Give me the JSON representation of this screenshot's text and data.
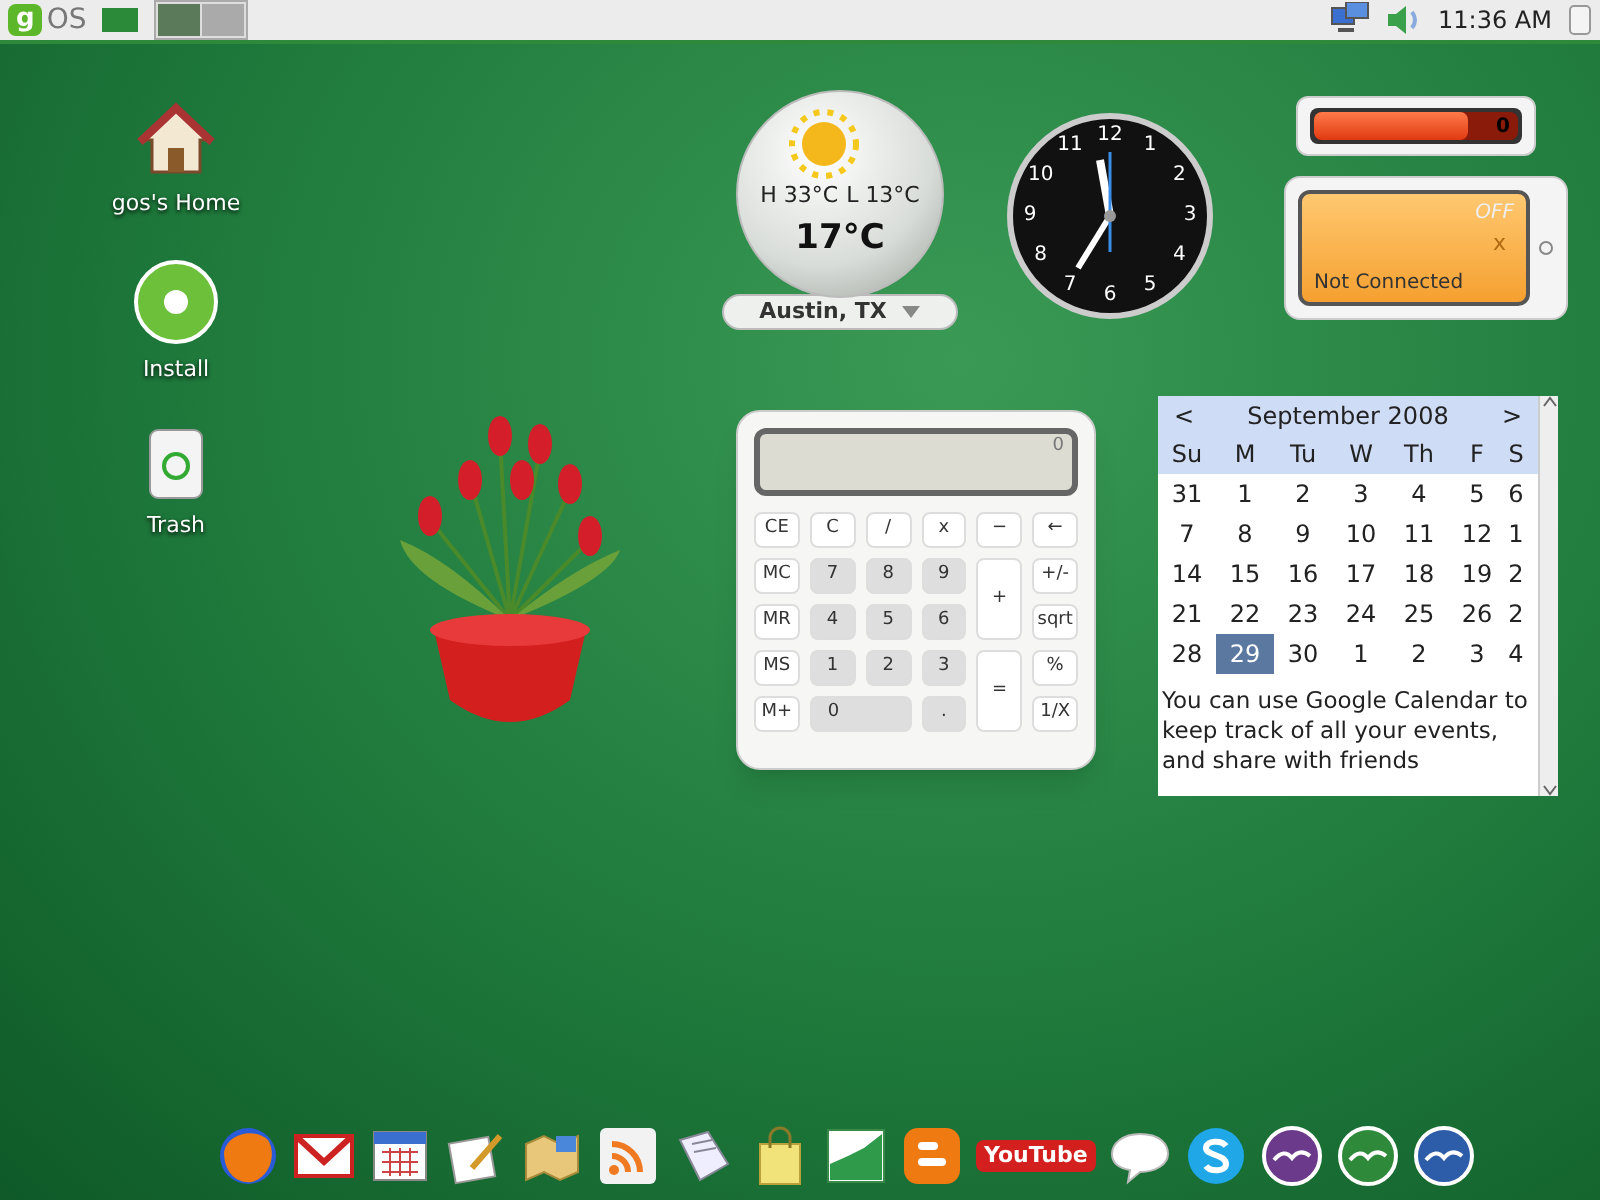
{
  "taskbar": {
    "logo": {
      "mark": "g",
      "text": "OS"
    },
    "workspaces": [
      {
        "selected": true
      },
      {
        "selected": false
      }
    ],
    "clock": "11:36 AM"
  },
  "desktop_icons": [
    {
      "kind": "home",
      "label": "gos's Home"
    },
    {
      "kind": "install",
      "label": "Install"
    },
    {
      "kind": "trash",
      "label": "Trash"
    }
  ],
  "weather": {
    "high": "H 33°C",
    "low": "L 13°C",
    "temperature": "17°C",
    "location": "Austin, TX"
  },
  "clock": {
    "numerals": [
      "12",
      "1",
      "2",
      "3",
      "4",
      "5",
      "6",
      "7",
      "8",
      "9",
      "10",
      "11"
    ]
  },
  "battery": {
    "level": 0.75,
    "reading": "0"
  },
  "wifi": {
    "state": "OFF",
    "mark": "x",
    "status": "Not Connected"
  },
  "calculator": {
    "display": "0",
    "keys": [
      {
        "label": "CE",
        "kind": "func"
      },
      {
        "label": "C",
        "kind": "func"
      },
      {
        "label": "/",
        "kind": "func"
      },
      {
        "label": "x",
        "kind": "func"
      },
      {
        "label": "−",
        "kind": "func"
      },
      {
        "label": "←",
        "kind": "func"
      },
      {
        "label": "MC",
        "kind": "func"
      },
      {
        "label": "7",
        "kind": "digit"
      },
      {
        "label": "8",
        "kind": "digit"
      },
      {
        "label": "9",
        "kind": "digit"
      },
      {
        "label": "+",
        "kind": "tall"
      },
      {
        "label": "+/-",
        "kind": "func"
      },
      {
        "label": "MR",
        "kind": "func"
      },
      {
        "label": "4",
        "kind": "digit"
      },
      {
        "label": "5",
        "kind": "digit"
      },
      {
        "label": "6",
        "kind": "digit"
      },
      {
        "label": "sqrt",
        "kind": "func"
      },
      {
        "label": "MS",
        "kind": "func"
      },
      {
        "label": "1",
        "kind": "digit"
      },
      {
        "label": "2",
        "kind": "digit"
      },
      {
        "label": "3",
        "kind": "digit"
      },
      {
        "label": "=",
        "kind": "tall"
      },
      {
        "label": "%",
        "kind": "func"
      },
      {
        "label": "M+",
        "kind": "func"
      },
      {
        "label": "0",
        "kind": "wide"
      },
      {
        "label": ".",
        "kind": "digit"
      },
      {
        "label": "1/X",
        "kind": "func"
      }
    ]
  },
  "calendar": {
    "prev": "<",
    "title": "September 2008",
    "next": ">",
    "weekdays": [
      "Su",
      "M",
      "Tu",
      "W",
      "Th",
      "F",
      "S"
    ],
    "weeks": [
      [
        {
          "day": "31",
          "selected": false
        },
        {
          "day": "1",
          "selected": false
        },
        {
          "day": "2",
          "selected": false
        },
        {
          "day": "3",
          "selected": false
        },
        {
          "day": "4",
          "selected": false
        },
        {
          "day": "5",
          "selected": false
        },
        {
          "day": "6",
          "selected": false
        }
      ],
      [
        {
          "day": "7",
          "selected": false
        },
        {
          "day": "8",
          "selected": false
        },
        {
          "day": "9",
          "selected": false
        },
        {
          "day": "10",
          "selected": false
        },
        {
          "day": "11",
          "selected": false
        },
        {
          "day": "12",
          "selected": false
        },
        {
          "day": "1",
          "selected": false
        }
      ],
      [
        {
          "day": "14",
          "selected": false
        },
        {
          "day": "15",
          "selected": false
        },
        {
          "day": "16",
          "selected": false
        },
        {
          "day": "17",
          "selected": false
        },
        {
          "day": "18",
          "selected": false
        },
        {
          "day": "19",
          "selected": false
        },
        {
          "day": "2",
          "selected": false
        }
      ],
      [
        {
          "day": "21",
          "selected": false
        },
        {
          "day": "22",
          "selected": false
        },
        {
          "day": "23",
          "selected": false
        },
        {
          "day": "24",
          "selected": false
        },
        {
          "day": "25",
          "selected": false
        },
        {
          "day": "26",
          "selected": false
        },
        {
          "day": "2",
          "selected": false
        }
      ],
      [
        {
          "day": "28",
          "selected": false
        },
        {
          "day": "29",
          "selected": true
        },
        {
          "day": "30",
          "selected": false
        },
        {
          "day": "1",
          "selected": false
        },
        {
          "day": "2",
          "selected": false
        },
        {
          "day": "3",
          "selected": false
        },
        {
          "day": "4",
          "selected": false
        }
      ]
    ],
    "note": "You can use Google Calendar to keep track of all your events, and share with friends"
  },
  "dock": [
    {
      "kind": "firefox"
    },
    {
      "kind": "mail"
    },
    {
      "kind": "calendar"
    },
    {
      "kind": "spreadsheet-pen"
    },
    {
      "kind": "map"
    },
    {
      "kind": "rss"
    },
    {
      "kind": "news"
    },
    {
      "kind": "bag"
    },
    {
      "kind": "chart"
    },
    {
      "kind": "blog"
    },
    {
      "kind": "video",
      "text": "YouTube"
    },
    {
      "kind": "chat"
    },
    {
      "kind": "skype"
    },
    {
      "kind": "office-purple"
    },
    {
      "kind": "office-green"
    },
    {
      "kind": "office-blue"
    }
  ]
}
